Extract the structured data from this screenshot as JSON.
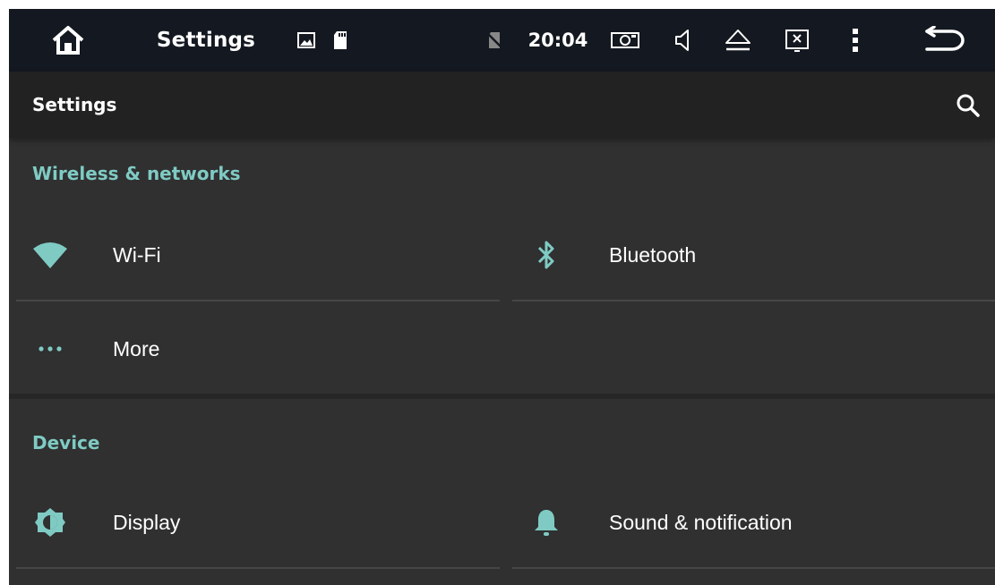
{
  "system_bar": {
    "title": "Settings",
    "clock": "20:04",
    "icons": [
      "home-icon",
      "image-icon",
      "sd-card-icon",
      "no-sim-icon",
      "screenshot-icon",
      "volume-icon",
      "eject-icon",
      "close-window-icon",
      "more-vert-icon",
      "back-icon"
    ]
  },
  "action_bar": {
    "title": "Settings",
    "search_icon": "search-icon"
  },
  "sections": [
    {
      "header": "Wireless & networks",
      "items": [
        {
          "label": "Wi-Fi",
          "icon": "wifi-icon"
        },
        {
          "label": "Bluetooth",
          "icon": "bluetooth-icon"
        },
        {
          "label": "More",
          "icon": "more-horiz-icon"
        }
      ]
    },
    {
      "header": "Device",
      "items": [
        {
          "label": "Display",
          "icon": "brightness-icon"
        },
        {
          "label": "Sound & notification",
          "icon": "bell-icon"
        }
      ]
    }
  ],
  "colors": {
    "accent": "#7fcbc4",
    "background": "#303030",
    "system_bar": "#141820",
    "action_bar": "#222222"
  }
}
